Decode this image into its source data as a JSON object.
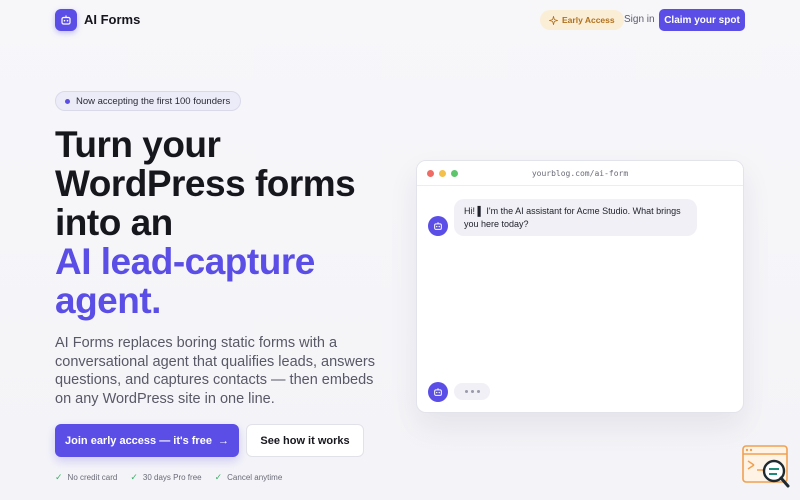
{
  "header": {
    "logo_text": "AI Forms",
    "early_access": "Early Access",
    "sign_in": "Sign in",
    "claim": "Claim your spot"
  },
  "hero": {
    "pill": "Now accepting the first 100 founders",
    "headline_lines": [
      "Turn your",
      "WordPress forms",
      "into an"
    ],
    "headline_accent_lines": [
      "AI lead-capture",
      "agent."
    ],
    "description": "AI Forms replaces boring static forms with a conversational agent that qualifies leads, answers questions, and captures contacts — then embeds on any WordPress site in one line.",
    "cta_primary": "Join early access — it's free",
    "cta_primary_arrow": "→",
    "cta_secondary": "See how it works",
    "features": [
      "No credit card",
      "30 days Pro free",
      "Cancel anytime"
    ],
    "check_glyph": "✓"
  },
  "browser": {
    "url": "yourblog.com/ai-form",
    "message": "Hi! ▌ I'm the AI assistant for Acme Studio. What brings you here today?"
  },
  "colors": {
    "accent": "#5a4ee6",
    "early_bg": "#fbeed7",
    "early_fg": "#b0701b",
    "check": "#3fae6a"
  },
  "icons": {
    "logo": "robot-icon",
    "early_access": "sparkle-icon",
    "avatar": "robot-icon",
    "corner": "search-widget-icon"
  }
}
